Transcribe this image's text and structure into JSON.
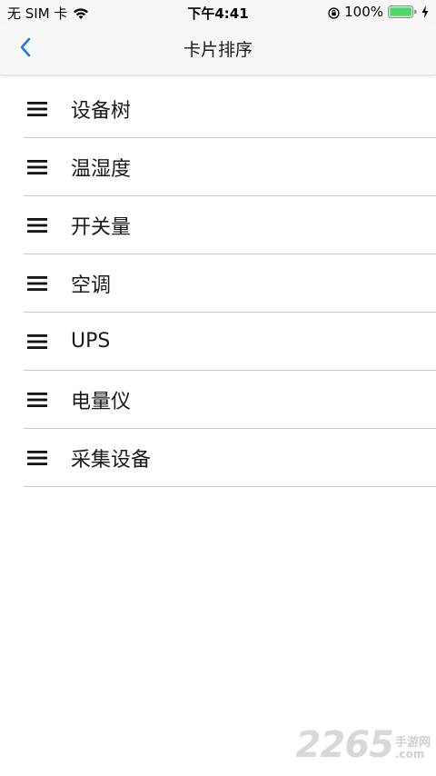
{
  "status_bar": {
    "carrier": "无 SIM 卡",
    "time": "下午4:41",
    "battery": "100%",
    "battery_color": "#4cd964"
  },
  "nav": {
    "back_icon": "chevron-left-icon",
    "title": "卡片排序",
    "accent_color": "#1a7de0"
  },
  "cards": [
    {
      "label": "设备树"
    },
    {
      "label": "温湿度"
    },
    {
      "label": "开关量"
    },
    {
      "label": "空调"
    },
    {
      "label": "UPS"
    },
    {
      "label": "电量仪"
    },
    {
      "label": "采集设备"
    }
  ],
  "watermark": {
    "digits": "2265",
    "side_top": "手游网",
    "side_bottom": ".com"
  }
}
